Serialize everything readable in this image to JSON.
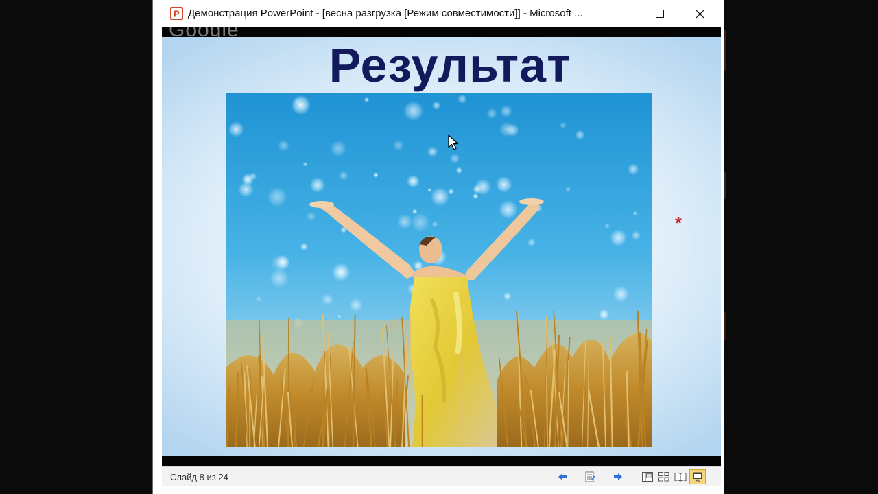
{
  "window": {
    "title": "Демонстрация PowerPoint - [весна разгрузка [Режим совместимости]] - Microsoft ...",
    "app_icon": "powerpoint-icon",
    "controls": [
      "minimize-icon",
      "maximize-icon",
      "close-icon"
    ]
  },
  "overlay": {
    "watermark": "Google"
  },
  "slide": {
    "title": "Результат",
    "image": "woman-in-yellow-dress-wheat-field-photo",
    "decoration": "*"
  },
  "statusbar": {
    "slide_counter": "Слайд 8 из 24",
    "buttons": [
      "previous-slide-icon",
      "notes-icon",
      "next-slide-icon",
      "normal-view-icon",
      "slide-sorter-icon",
      "reading-view-icon",
      "slide-show-icon"
    ]
  },
  "colors": {
    "title_text": "#121a5c",
    "slide_background": "#d4e8f7",
    "sky": "#2a9fd8",
    "wheat": "#c7962e",
    "dress": "#e7d23a",
    "asterisk": "#c0262e",
    "active_view": "#f5d77a"
  }
}
